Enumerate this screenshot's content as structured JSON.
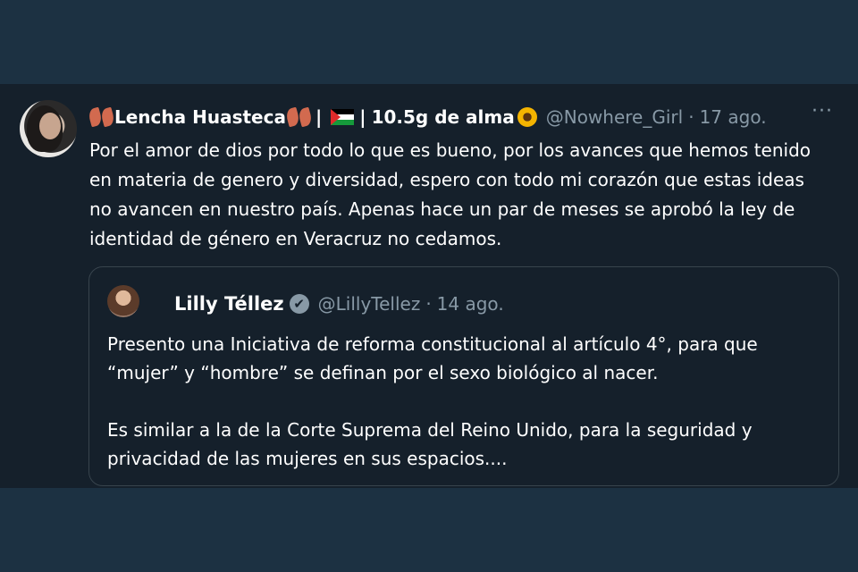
{
  "tweet": {
    "display_name": "Lencha Huasteca",
    "display_name_suffix": "10.5g de alma",
    "handle": "@Nowhere_Girl",
    "date": "17 ago.",
    "more": "···",
    "text": "Por el amor de dios por todo lo que es bueno, por los avances que hemos tenido en materia de genero y diversidad, espero con todo mi corazón que estas ideas no avancen en nuestro país. Apenas hace un par de meses se aprobó la ley de identidad de género en Veracruz no cedamos."
  },
  "quoted_tweet": {
    "display_name": "Lilly Téllez",
    "verified_glyph": "✔",
    "handle": "@LillyTellez",
    "date": "14 ago.",
    "paragraph_1": "Presento una Iniciativa de reforma constitucional al artículo 4°, para que “mujer” y “hombre” se definan por el sexo biológico al nacer.",
    "paragraph_2": "Es similar a la de la Corte Suprema del Reino Unido, para la seguridad y privacidad de las mujeres en sus espacios...."
  },
  "icons": {
    "name_decoration": "leaf-icon",
    "flag": "palestine-flag-icon",
    "sunflower": "sunflower-icon",
    "verified": "verified-badge-icon"
  },
  "colors": {
    "background": "#15202b",
    "outer_band": "#1c3142",
    "secondary_text": "#8899a6",
    "border": "#38444d"
  }
}
